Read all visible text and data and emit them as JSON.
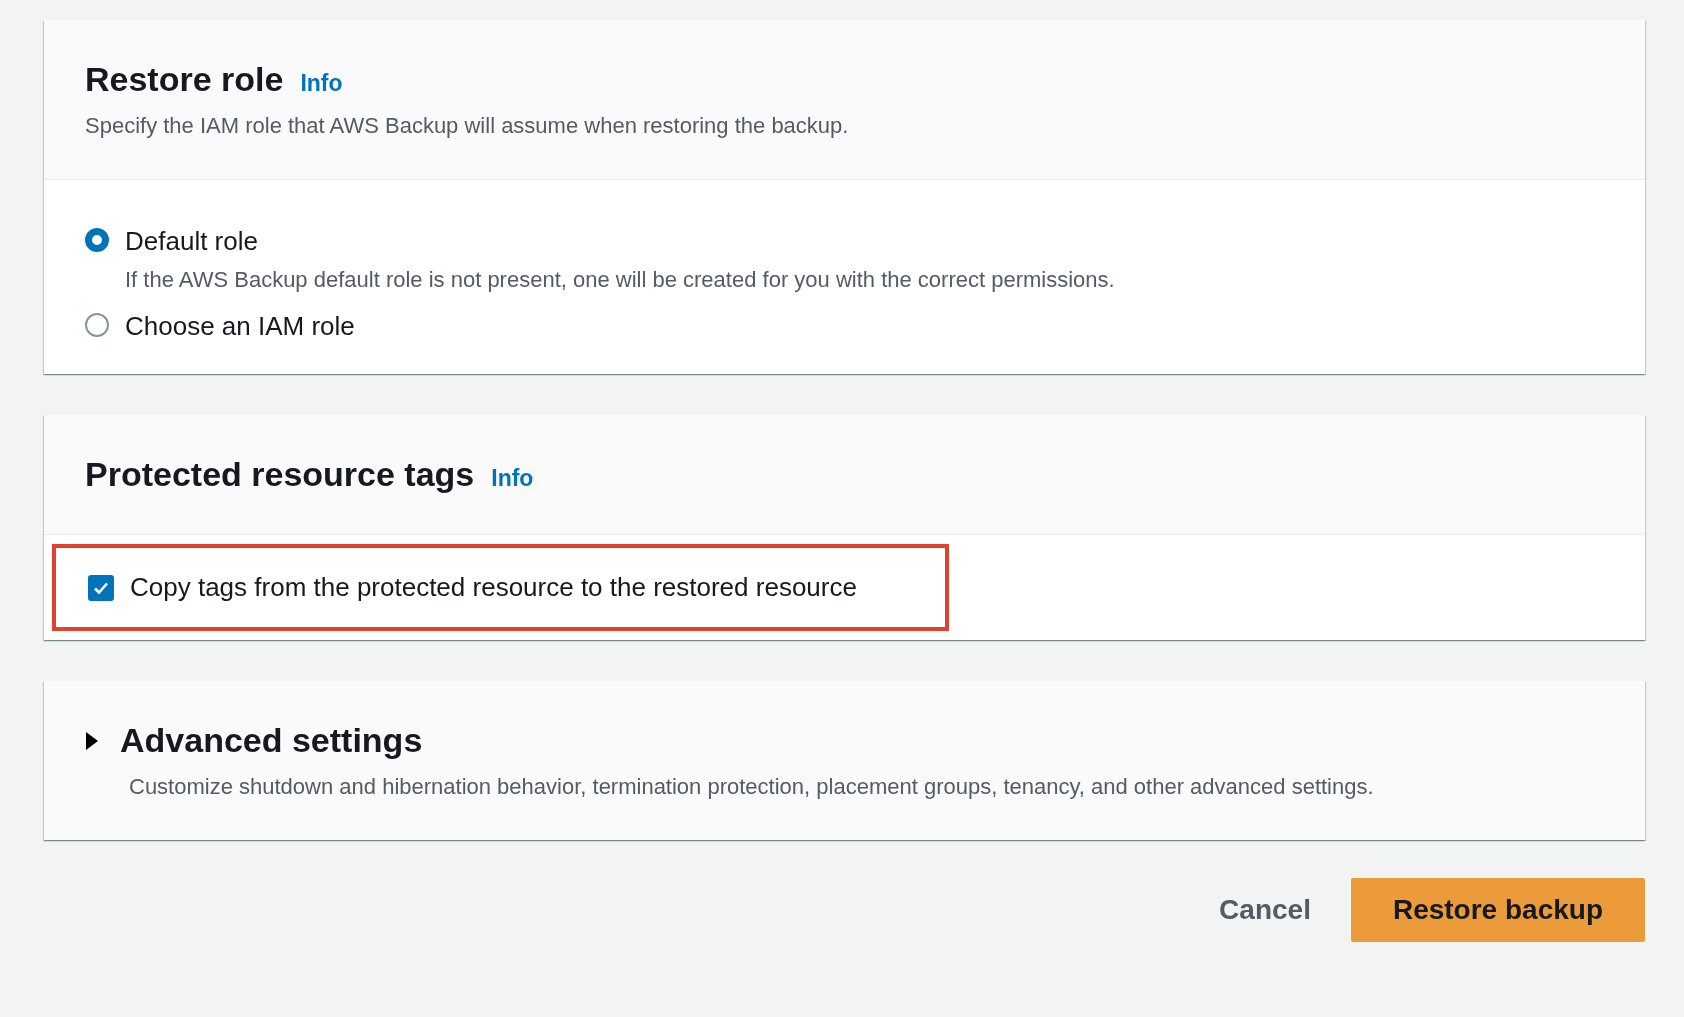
{
  "restore_role": {
    "title": "Restore role",
    "info": "Info",
    "description": "Specify the IAM role that AWS Backup will assume when restoring the backup.",
    "options": [
      {
        "label": "Default role",
        "description": "If the AWS Backup default role is not present, one will be created for you with the correct permissions.",
        "selected": true
      },
      {
        "label": "Choose an IAM role",
        "selected": false
      }
    ]
  },
  "protected_resource_tags": {
    "title": "Protected resource tags",
    "info": "Info",
    "checkbox": {
      "label": "Copy tags from the protected resource to the restored resource",
      "checked": true,
      "highlighted": true
    }
  },
  "advanced_settings": {
    "title": "Advanced settings",
    "description": "Customize shutdown and hibernation behavior, termination protection, placement groups, tenancy, and other advanced settings.",
    "expanded": false
  },
  "buttons": [
    {
      "label": "Cancel",
      "kind": "link"
    },
    {
      "label": "Restore backup",
      "kind": "primary"
    }
  ]
}
